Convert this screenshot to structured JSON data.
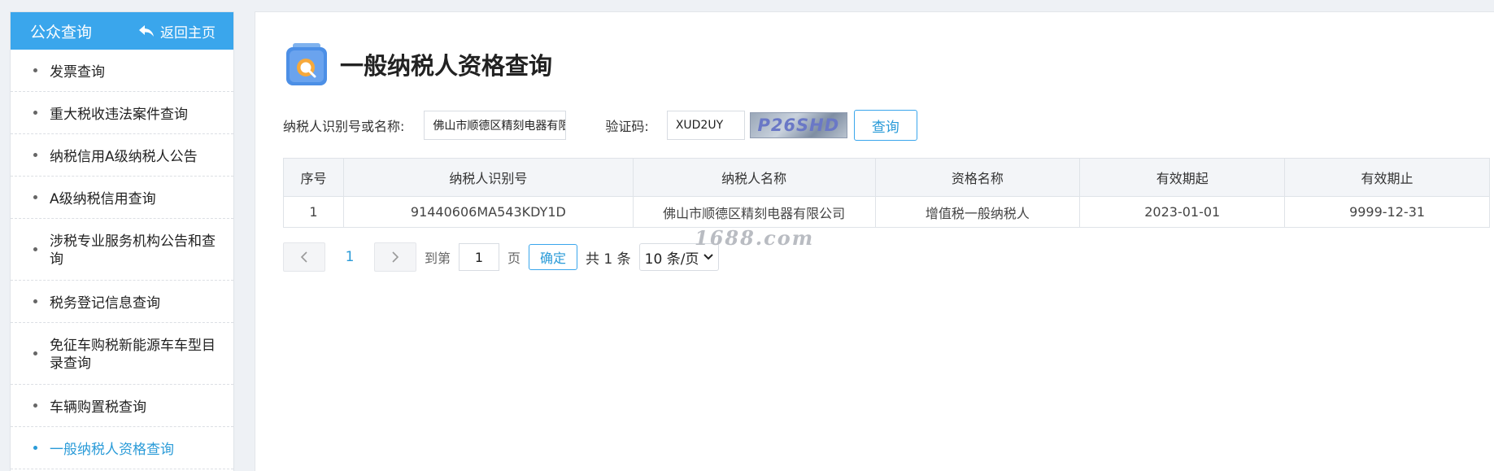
{
  "sidebar": {
    "title": "公众查询",
    "home_label": "返回主页",
    "items": [
      {
        "label": "发票查询"
      },
      {
        "label": "重大税收违法案件查询"
      },
      {
        "label": "纳税信用A级纳税人公告"
      },
      {
        "label": "A级纳税信用查询"
      },
      {
        "label": "涉税专业服务机构公告和查询"
      },
      {
        "label": "税务登记信息查询"
      },
      {
        "label": "免征车购税新能源车车型目录查询"
      },
      {
        "label": "车辆购置税查询"
      },
      {
        "label": "一般纳税人资格查询"
      }
    ]
  },
  "page": {
    "title": "一般纳税人资格查询"
  },
  "search": {
    "name_label": "纳税人识别号或名称:",
    "name_value": "佛山市顺德区精刻电器有限公司",
    "code_label": "验证码:",
    "code_value": "XUD2UY",
    "captcha_text": "P26SHD",
    "query_label": "查询"
  },
  "table": {
    "headers": [
      "序号",
      "纳税人识别号",
      "纳税人名称",
      "资格名称",
      "有效期起",
      "有效期止"
    ],
    "rows": [
      [
        "1",
        "91440606MA543KDY1D",
        "佛山市顺德区精刻电器有限公司",
        "增值税一般纳税人",
        "2023-01-01",
        "9999-12-31"
      ]
    ]
  },
  "pagination": {
    "current_page": "1",
    "goto_prefix": "到第",
    "goto_value": "1",
    "goto_suffix": "页",
    "confirm_label": "确定",
    "total_text": "共 1 条",
    "page_size": "10 条/页"
  },
  "watermark": "1688.com",
  "colors": {
    "accent": "#3aa6ec",
    "link": "#2a9bd8",
    "background": "#eef1f5"
  }
}
